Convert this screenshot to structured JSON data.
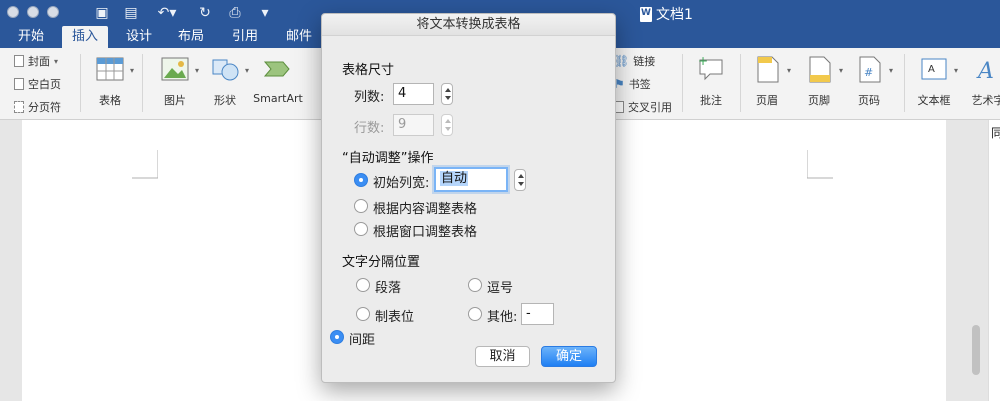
{
  "window": {
    "doc_title": "文档1"
  },
  "tabs": [
    "开始",
    "插入",
    "设计",
    "布局",
    "引用",
    "邮件"
  ],
  "ribbon": {
    "pages": {
      "cover": "封面",
      "blank": "空白页",
      "pagebreak": "分页符"
    },
    "table": "表格",
    "picture": "图片",
    "shapes": "形状",
    "smartart": "SmartArt",
    "links": {
      "link": "链接",
      "bookmark": "书签",
      "crossref": "交叉引用"
    },
    "comment": "批注",
    "header": "页眉",
    "footer": "页脚",
    "pagenum": "页码",
    "textbox": "文本框",
    "wordart": "艺术字"
  },
  "right_panel_char": "同",
  "dialog": {
    "title": "将文本转换成表格",
    "size_section": "表格尺寸",
    "columns_label": "列数:",
    "columns_value": "4",
    "rows_label": "行数:",
    "rows_value": "9",
    "autofit_section": "“自动调整”操作",
    "fixed_width_label": "初始列宽:",
    "fixed_width_value": "自动",
    "autofit_contents": "根据内容调整表格",
    "autofit_window": "根据窗口调整表格",
    "separate_section": "文字分隔位置",
    "sep_paragraph": "段落",
    "sep_comma": "逗号",
    "sep_tab": "制表位",
    "sep_other": "其他:",
    "sep_other_value": "-",
    "sep_space": "间距",
    "cancel": "取消",
    "ok": "确定"
  },
  "colors": {
    "accent": "#2b579a",
    "primary_button": "#1f7ff3"
  }
}
